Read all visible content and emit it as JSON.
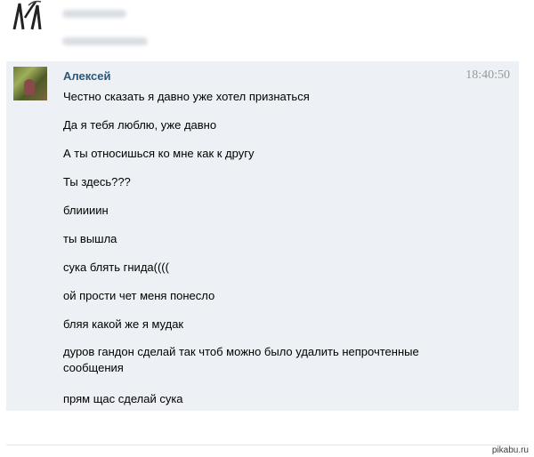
{
  "previous": {
    "avatar_icon": "trees-sketch-avatar"
  },
  "message": {
    "author": "Алексей",
    "time": "18:40:50",
    "avatar_icon": "user-photo-avatar",
    "lines": [
      "Честно сказать я давно уже хотел признаться",
      "Да я тебя люблю, уже давно",
      "А ты относишься ко мне как к другу",
      "Ты здесь???",
      "блиииин",
      "ты вышла",
      "сука блять гнида((((",
      "ой прости чет меня понесло",
      "бляя какой же я мудак",
      "дуров гандон сделай так чтоб можно было удалить непрочтенные сообщения",
      "прям щас сделай сука"
    ]
  },
  "watermark": "pikabu.ru",
  "colors": {
    "author": "#2b587a",
    "block_bg": "#edf1f5",
    "time": "#999999"
  }
}
